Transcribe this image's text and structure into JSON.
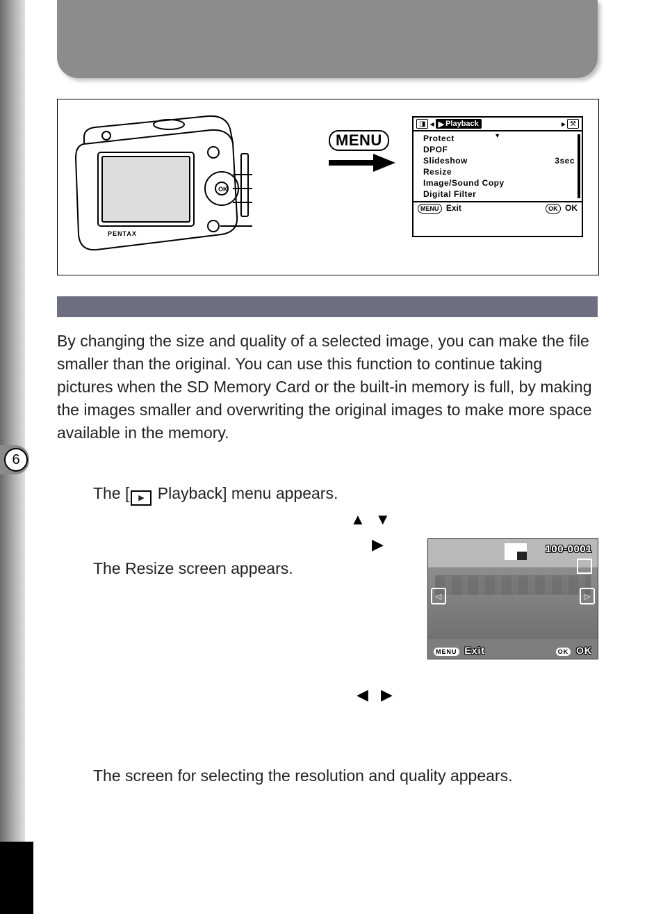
{
  "tab_number": "6",
  "menu_button_label": "MENU",
  "playback_menu": {
    "title": "Playback",
    "items": [
      "Protect",
      "DPOF",
      "Slideshow",
      "Resize",
      "Image/Sound Copy",
      "Digital Filter"
    ],
    "slideshow_value": "3sec",
    "exit_label": "Exit",
    "ok_label": "OK",
    "menu_pill": "MENU",
    "ok_pill": "OK"
  },
  "body_text": "By changing the size and quality of a selected image, you can make the file smaller than the original. You can use this function to continue taking pictures when the SD Memory Card or the built-in memory is full, by making the images smaller and overwriting the original images to make more space available in the memory.",
  "step1_result_pre": "The [",
  "step1_result_post": " Playback] menu appears.",
  "step3_result": "The Resize screen appears.",
  "step5_result": "The screen for selecting the resolution and quality appears.",
  "arrows": {
    "up_down": "▲ ▼",
    "right": "▶",
    "left_right": "◀ ▶"
  },
  "resize_screen": {
    "id": "100-0001",
    "exit": "Exit",
    "ok": "OK",
    "menu_pill": "MENU",
    "ok_pill": "OK",
    "nav_left": "◁",
    "nav_right": "▷"
  }
}
